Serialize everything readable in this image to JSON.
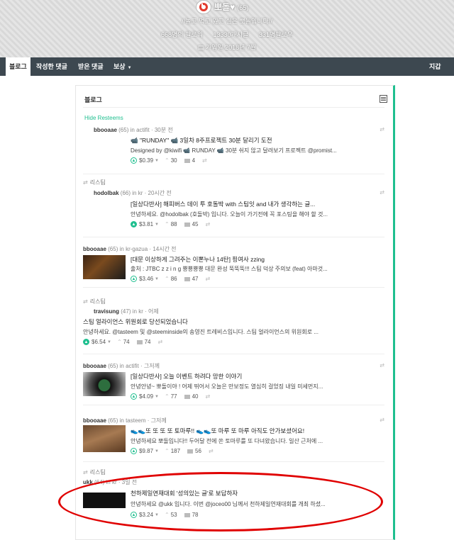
{
  "profile": {
    "name": "뽀돌♥",
    "reputation": "(65)",
    "tagline": "//놀고 먹고 잃고 싶은 뽀돌입니다//",
    "followers": "668명의 팔로워",
    "posts": "13330개시글",
    "following": "331명팔로우",
    "joined": "가입일 2018년 7월"
  },
  "nav": {
    "tabs": [
      "블로그",
      "작성한 댓글",
      "받은 댓글",
      "보상"
    ],
    "wallet": "지갑"
  },
  "panel": {
    "title": "블로그",
    "hide_resteems": "Hide Resteems"
  },
  "posts": [
    {
      "resteem": "",
      "author": "bbooaae",
      "rep": "(65)",
      "in": "in",
      "tag": "actifit",
      "time": "30분 전",
      "title": "📹 \"RUNDAY\" 📹 3일차 8주프로젝트 30분 달리기 도전",
      "body": "Designed by @kiwifi 📹 RUNDAY 📹 30분 쉬지 않고 달려보기 프로젝트 @promist...",
      "payout": "$0.39",
      "votes": "30",
      "comments": "4"
    },
    {
      "resteem": "리스팀",
      "author": "hodolbak",
      "rep": "(66)",
      "in": "in",
      "tag": "kr",
      "time": "20시간 전",
      "title": "[일상다반사] 해피버스 데이 투 호돌박 with 스팀잇 and 내가 생각하는 글...",
      "body": "안녕하세요. @hodolbak (호돌박) 입니다. 오늘이 가기전에 꼭 포스팅을 해야 할 것...",
      "payout": "$3.81",
      "votes": "88",
      "comments": "45"
    },
    {
      "resteem": "",
      "author": "bbooaae",
      "rep": "(65)",
      "in": "in",
      "tag": "kr-gazua",
      "time": "14시간 전",
      "title": "[대문 이상하게 그려주는 이뽄누나 14탄] 핑여사 zzing",
      "body": "출처 : JTBC z z i n g 뿅뿅뿅뿅 대문 완성 뚝뚝뚝!!! 스팀 덕상 주의보 (feat) 아마것...",
      "payout": "$3.46",
      "votes": "86",
      "comments": "47"
    },
    {
      "resteem": "리스팀",
      "author": "travisung",
      "rep": "(47)",
      "in": "in",
      "tag": "kr",
      "time": "어제",
      "title": "스팀 얼라이언스 위원회로 당선되었습니다",
      "body": "안녕하세요. @tasteem 및 @steeminside의 송영진 트레비스입니다. 스팀 얼라이언스의 위원회로 ...",
      "payout": "$6.54",
      "votes": "74",
      "comments": "74"
    },
    {
      "resteem": "",
      "author": "bbooaae",
      "rep": "(65)",
      "in": "in",
      "tag": "actifit",
      "time": "그저께",
      "title": "[일상다반사] 오늘 이벤트 하려다 망한 이야기",
      "body": "안녕안녕~ 뽀돌이야 ! 어제 뛰어서 오늘은 만보정도 열심히 걸었징 내일 미세먼지...",
      "payout": "$4.09",
      "votes": "77",
      "comments": "40"
    },
    {
      "resteem": "",
      "author": "bbooaae",
      "rep": "(65)",
      "in": "in",
      "tag": "tasteem",
      "time": "그저께",
      "title": "👟👟또 또 또 또 토마루!! 👟👟또 마루 또 마루 아직도 안가보셨어요!",
      "body": "안녕하세요 뽀돌입니다!! 두어달 전에 쏜 토마루를 또 다녀왔습니다. 일산 근처에 ...",
      "payout": "$9.87",
      "votes": "187",
      "comments": "56"
    },
    {
      "resteem": "리스팀",
      "author": "ukk",
      "rep": "(64)",
      "in": "in",
      "tag": "kr",
      "time": "3일 전",
      "title": "천하제일연재대회 '성의있는 글'로 보답하자",
      "body": "안녕하세요 @ukk 입니다. 이번 @joceo00 님께서 천하제일연재대회를 개최 하셨...",
      "payout": "$3.24",
      "votes": "53",
      "comments": "78"
    }
  ],
  "colors": {
    "accent": "#1fbf8f",
    "nav": "#3d4850",
    "highlight": "#e00000"
  }
}
